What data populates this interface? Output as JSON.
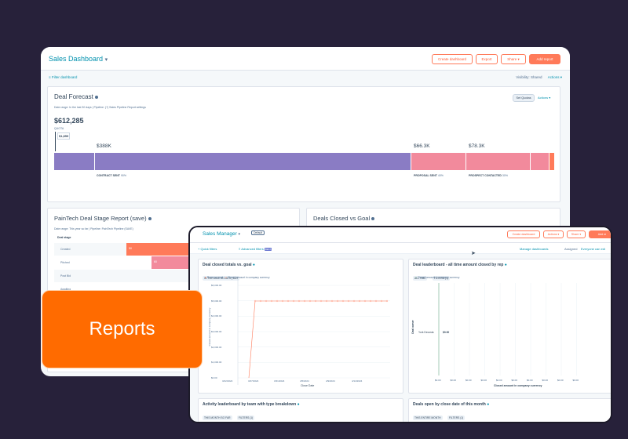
{
  "back": {
    "title": "Sales Dashboard",
    "buttons": {
      "create": "Create dashboard",
      "export": "Export",
      "share": "Share ▾",
      "add_report": "Add report"
    },
    "filter": "Filter dashboard",
    "visibility_label": "Visibility:",
    "visibility_value": "Shared",
    "actions": "Actions ▾",
    "forecast": {
      "title": "Deal Forecast",
      "meta": "Date range: In the last 30 days  |  Pipeline: (?) Sales Pipeline  Report settings",
      "set_quotas": "Set Quotas",
      "actions": "Actions ▾",
      "total": "$612,285",
      "quota_label": "QUOTA",
      "quota_value": "$1,859",
      "seg1_value": "$388K",
      "seg1_label": "CONTRACT SENT",
      "seg1_pct": "90%",
      "seg2_value": "$66.3K",
      "seg2_label": "PROPOSAL SENT",
      "seg2_pct": "40%",
      "seg3_value": "$78.3K",
      "seg3_label": "PROSPECT CONTACTED",
      "seg3_pct": "30%"
    },
    "stage": {
      "title": "PainTech Deal Stage Report (save)",
      "meta": "Date range: This year so far  |  Pipeline: PainTech Pipeline (SAVE)",
      "col": "Deal stage",
      "rows": [
        {
          "label": "Created",
          "val": "50"
        },
        {
          "label": "Pitched",
          "val": "60"
        },
        {
          "label": "Post Bid",
          "val": ""
        },
        {
          "label": "Awaiting",
          "val": ""
        }
      ]
    },
    "closed_vs_goal": {
      "title": "Deals Closed vs Goal"
    }
  },
  "front": {
    "title": "Sales Manager",
    "default_badge": "Default",
    "buttons": {
      "create": "Create dashboard",
      "actions": "Actions ▾",
      "share": "Share ▾",
      "add": "Add re"
    },
    "quick_filters": "Quick filters",
    "advanced_filters": "Advanced filters",
    "beta": "BETA",
    "manage": "Manage dashboards",
    "assigned": "Assigned",
    "everyone": "Everyone can edi",
    "closed": {
      "title": "Deal closed totals vs. goal",
      "tags": [
        "IN THE LAST 30 DAYS | DAY"
      ],
      "legend": [
        "Revenue goal",
        "Closed amount in company currency"
      ],
      "y_label": "Closed amount in company currency",
      "x_label": "Close Date",
      "y_ticks": [
        "$6,000.00",
        "$5,000.00",
        "$4,000.00",
        "$3,000.00",
        "$2,000.00",
        "$1,000.00",
        "$0.00"
      ],
      "x_ticks": [
        "3/22/2024",
        "3/27/2024",
        "3/31/2024",
        "4/5/2024",
        "4/9/2024",
        "4/14/2024"
      ]
    },
    "leaderboard": {
      "title": "Deal leaderboard - all time amount closed by rep",
      "tags": [
        "ALL TIME",
        "FILTERS (1)"
      ],
      "legend": "Closed amount in company currency",
      "y_label": "Deal owner",
      "rep": "York Decosta",
      "rep_value": "$0.00",
      "x_label": "Closed amount in company currency",
      "x_ticks": [
        "$0.00",
        "$0.00",
        "$0.00",
        "$0.00",
        "$0.00",
        "$0.00",
        "$0.00",
        "$0.00",
        "$0.00",
        "$0.00"
      ]
    },
    "activity": {
      "title": "Activity leaderboard by team with type breakdown",
      "tags": [
        "THIS MONTH SO FAR",
        "FILTERS (1)"
      ]
    },
    "open_deals": {
      "title": "Deals open by close date of this month",
      "tags": [
        "THIS ENTIRE MONTH",
        "FILTERS (1)"
      ]
    }
  },
  "badge": "Reports",
  "colors": {
    "purple": "#8a7cc4",
    "pink": "#f28a9c",
    "orange": "#ff7a59",
    "badge": "#ff6b00"
  }
}
